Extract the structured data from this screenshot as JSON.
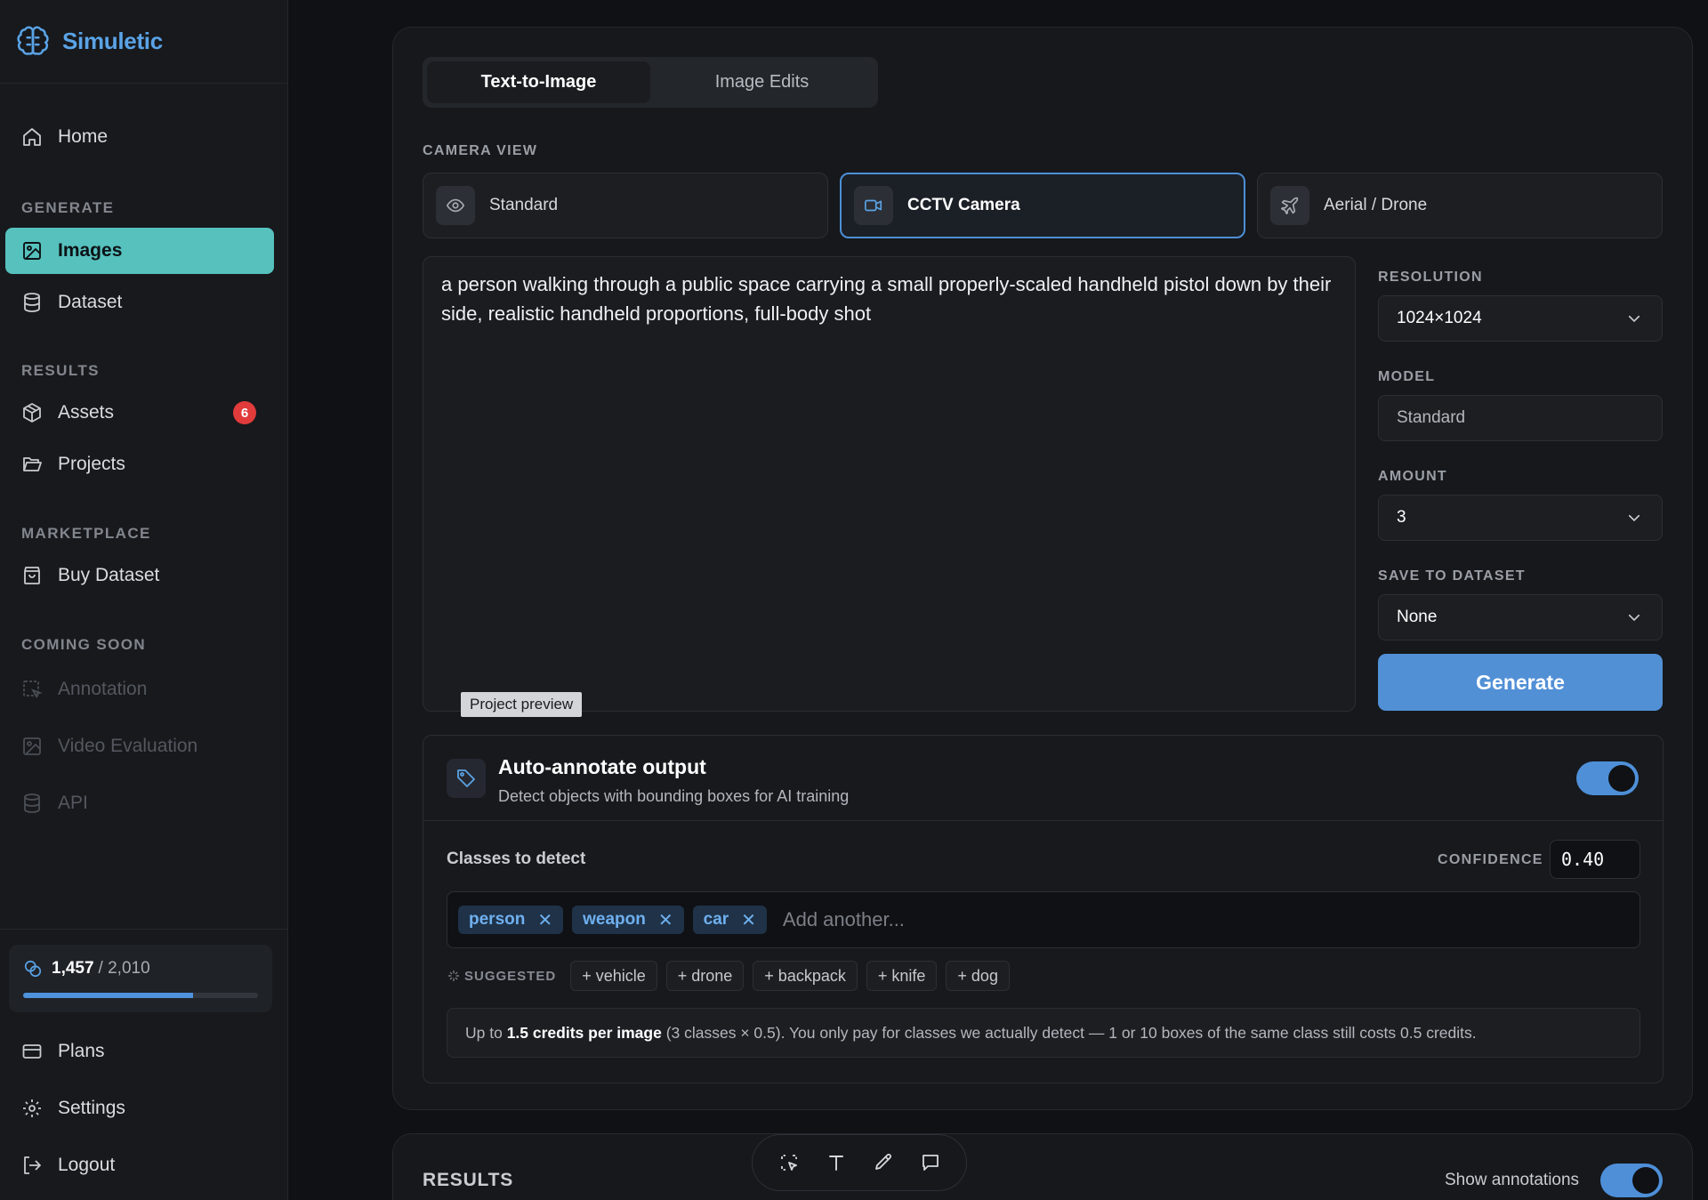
{
  "brand": {
    "name": "Simuletic"
  },
  "sidebar": {
    "home": "Home",
    "sections": {
      "generate": "GENERATE",
      "results": "RESULTS",
      "marketplace": "MARKETPLACE",
      "coming_soon": "COMING SOON"
    },
    "items": {
      "images": "Images",
      "dataset": "Dataset",
      "assets": "Assets",
      "assets_badge": "6",
      "projects": "Projects",
      "buy_dataset": "Buy Dataset",
      "annotation": "Annotation",
      "video_evaluation": "Video Evaluation",
      "api": "API"
    },
    "credits": {
      "used": "1,457",
      "total": "/ 2,010",
      "fraction": 0.725
    },
    "footer": {
      "plans": "Plans",
      "settings": "Settings",
      "logout": "Logout"
    }
  },
  "main": {
    "tabs": [
      {
        "label": "Text-to-Image",
        "active": true
      },
      {
        "label": "Image Edits",
        "active": false
      }
    ],
    "camera_view_label": "CAMERA VIEW",
    "camera_options": [
      {
        "label": "Standard",
        "icon": "eye-icon",
        "selected": false
      },
      {
        "label": "CCTV Camera",
        "icon": "video-camera-icon",
        "selected": true
      },
      {
        "label": "Aerial / Drone",
        "icon": "plane-icon",
        "selected": false
      }
    ],
    "prompt": "a person walking through a public space carrying a small properly-scaled handheld pistol down by their side, realistic handheld proportions, full-body shot",
    "preview_tag": "Project preview",
    "settings": {
      "resolution_label": "RESOLUTION",
      "resolution_value": "1024×1024",
      "model_label": "MODEL",
      "model_value": "Standard",
      "amount_label": "AMOUNT",
      "amount_value": "3",
      "save_label": "SAVE TO DATASET",
      "save_value": "None"
    },
    "generate_button": "Generate",
    "annotate": {
      "title": "Auto-annotate output",
      "subtitle": "Detect objects with bounding boxes for AI training",
      "enabled": true,
      "classes_label": "Classes to detect",
      "confidence_label": "CONFIDENCE",
      "confidence_value": "0.40",
      "classes": [
        "person",
        "weapon",
        "car"
      ],
      "add_placeholder": "Add another...",
      "suggested_label": "SUGGESTED",
      "suggested": [
        "+ vehicle",
        "+ drone",
        "+ backpack",
        "+ knife",
        "+ dog"
      ],
      "info_prefix": "Up to ",
      "info_bold": "1.5 credits per image",
      "info_suffix": " (3 classes × 0.5). You only pay for classes we actually detect — 1 or 10 boxes of the same class still costs 0.5 credits."
    },
    "results": {
      "title": "RESULTS",
      "show_annotations": "Show annotations",
      "show_annotations_enabled": true
    }
  },
  "colors": {
    "accent": "#5290d6",
    "active_nav": "#56c1bd",
    "badge": "#e23b3b",
    "background": "#0f1114"
  }
}
